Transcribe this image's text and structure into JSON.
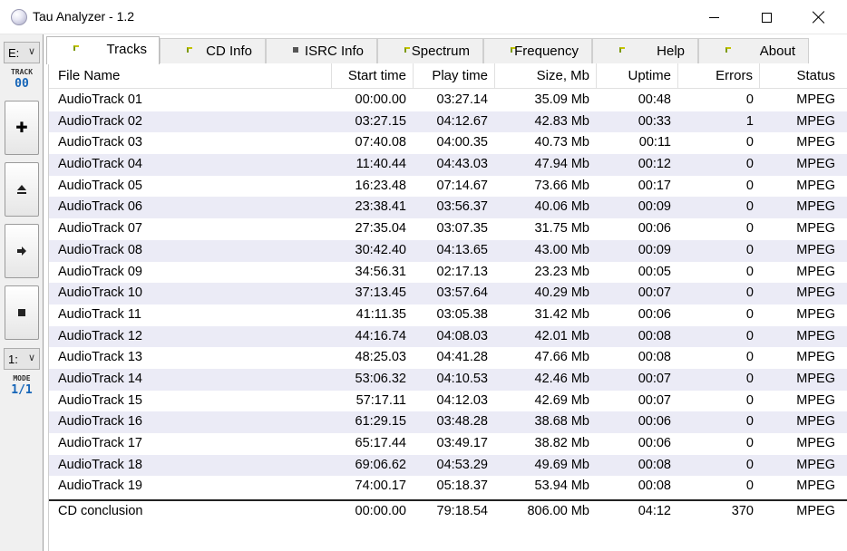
{
  "window": {
    "title": "Tau Analyzer - 1.2"
  },
  "left_toolbar": {
    "drive": "E:",
    "track_label": "TRACK",
    "track_value": "00",
    "buttons": [
      "plus-icon",
      "eject-icon",
      "next-icon",
      "stop-icon"
    ],
    "mode_select": "1:",
    "mode_label": "MODE",
    "mode_value": "1/1"
  },
  "tabs": [
    {
      "label": "Tracks",
      "indicator": "flag",
      "active": true
    },
    {
      "label": "CD Info",
      "indicator": "flag",
      "active": false
    },
    {
      "label": "ISRC Info",
      "indicator": "square",
      "active": false
    },
    {
      "label": "Spectrum",
      "indicator": "flag",
      "active": false
    },
    {
      "label": "Frequency",
      "indicator": "flag",
      "active": false
    },
    {
      "label": "Help",
      "indicator": "flag",
      "active": false
    },
    {
      "label": "About",
      "indicator": "flag",
      "active": false
    }
  ],
  "columns": [
    "File Name",
    "Start time",
    "Play time",
    "Size, Mb",
    "Uptime",
    "Errors",
    "Status"
  ],
  "rows": [
    [
      "AudioTrack 01",
      "00:00.00",
      "03:27.14",
      "35.09 Mb",
      "00:48",
      "0",
      "MPEG"
    ],
    [
      "AudioTrack 02",
      "03:27.15",
      "04:12.67",
      "42.83 Mb",
      "00:33",
      "1",
      "MPEG"
    ],
    [
      "AudioTrack 03",
      "07:40.08",
      "04:00.35",
      "40.73 Mb",
      "00:11",
      "0",
      "MPEG"
    ],
    [
      "AudioTrack 04",
      "11:40.44",
      "04:43.03",
      "47.94 Mb",
      "00:12",
      "0",
      "MPEG"
    ],
    [
      "AudioTrack 05",
      "16:23.48",
      "07:14.67",
      "73.66 Mb",
      "00:17",
      "0",
      "MPEG"
    ],
    [
      "AudioTrack 06",
      "23:38.41",
      "03:56.37",
      "40.06 Mb",
      "00:09",
      "0",
      "MPEG"
    ],
    [
      "AudioTrack 07",
      "27:35.04",
      "03:07.35",
      "31.75 Mb",
      "00:06",
      "0",
      "MPEG"
    ],
    [
      "AudioTrack 08",
      "30:42.40",
      "04:13.65",
      "43.00 Mb",
      "00:09",
      "0",
      "MPEG"
    ],
    [
      "AudioTrack 09",
      "34:56.31",
      "02:17.13",
      "23.23 Mb",
      "00:05",
      "0",
      "MPEG"
    ],
    [
      "AudioTrack 10",
      "37:13.45",
      "03:57.64",
      "40.29 Mb",
      "00:07",
      "0",
      "MPEG"
    ],
    [
      "AudioTrack 11",
      "41:11.35",
      "03:05.38",
      "31.42 Mb",
      "00:06",
      "0",
      "MPEG"
    ],
    [
      "AudioTrack 12",
      "44:16.74",
      "04:08.03",
      "42.01 Mb",
      "00:08",
      "0",
      "MPEG"
    ],
    [
      "AudioTrack 13",
      "48:25.03",
      "04:41.28",
      "47.66 Mb",
      "00:08",
      "0",
      "MPEG"
    ],
    [
      "AudioTrack 14",
      "53:06.32",
      "04:10.53",
      "42.46 Mb",
      "00:07",
      "0",
      "MPEG"
    ],
    [
      "AudioTrack 15",
      "57:17.11",
      "04:12.03",
      "42.69 Mb",
      "00:07",
      "0",
      "MPEG"
    ],
    [
      "AudioTrack 16",
      "61:29.15",
      "03:48.28",
      "38.68 Mb",
      "00:06",
      "0",
      "MPEG"
    ],
    [
      "AudioTrack 17",
      "65:17.44",
      "03:49.17",
      "38.82 Mb",
      "00:06",
      "0",
      "MPEG"
    ],
    [
      "AudioTrack 18",
      "69:06.62",
      "04:53.29",
      "49.69 Mb",
      "00:08",
      "0",
      "MPEG"
    ],
    [
      "AudioTrack 19",
      "74:00.17",
      "05:18.37",
      "53.94 Mb",
      "00:08",
      "0",
      "MPEG"
    ]
  ],
  "summary": [
    "CD conclusion",
    "00:00.00",
    "79:18.54",
    "806.00 Mb",
    "04:12",
    "370",
    "MPEG"
  ]
}
